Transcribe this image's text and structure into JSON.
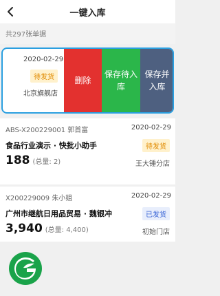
{
  "header": {
    "title": "一键入库",
    "back_icon": "chevron-left-icon"
  },
  "summary": {
    "text": "共297张单据"
  },
  "swiped_card": {
    "date": "2020-02-29",
    "status": "待发货",
    "store": "北京旗舰店",
    "actions": {
      "delete": "删除",
      "save_pending": "保存待入库",
      "save_store": "保存并入库"
    }
  },
  "orders": [
    {
      "code": "ABS-X200229001",
      "person": "郭首富",
      "date": "2020-02-29",
      "company": "食品行业演示 · 快批小助手",
      "status": "待发货",
      "quantity": "188",
      "total": "(总量: 2)",
      "store": "王大锤分店"
    },
    {
      "code": "X200229009",
      "person": "朱小姐",
      "date": "2020-02-29",
      "company": "广州市继航日用品贸易 · 魏银冲",
      "status": "已发货",
      "quantity": "3,940",
      "total": "(总量: 4,400)",
      "store": "初始门店"
    }
  ],
  "colors": {
    "accent": "#2a9fe0",
    "delete": "#e3312f",
    "save_pending": "#2bb64a",
    "save_store": "#4e6080",
    "logo": "#1aa34a"
  }
}
